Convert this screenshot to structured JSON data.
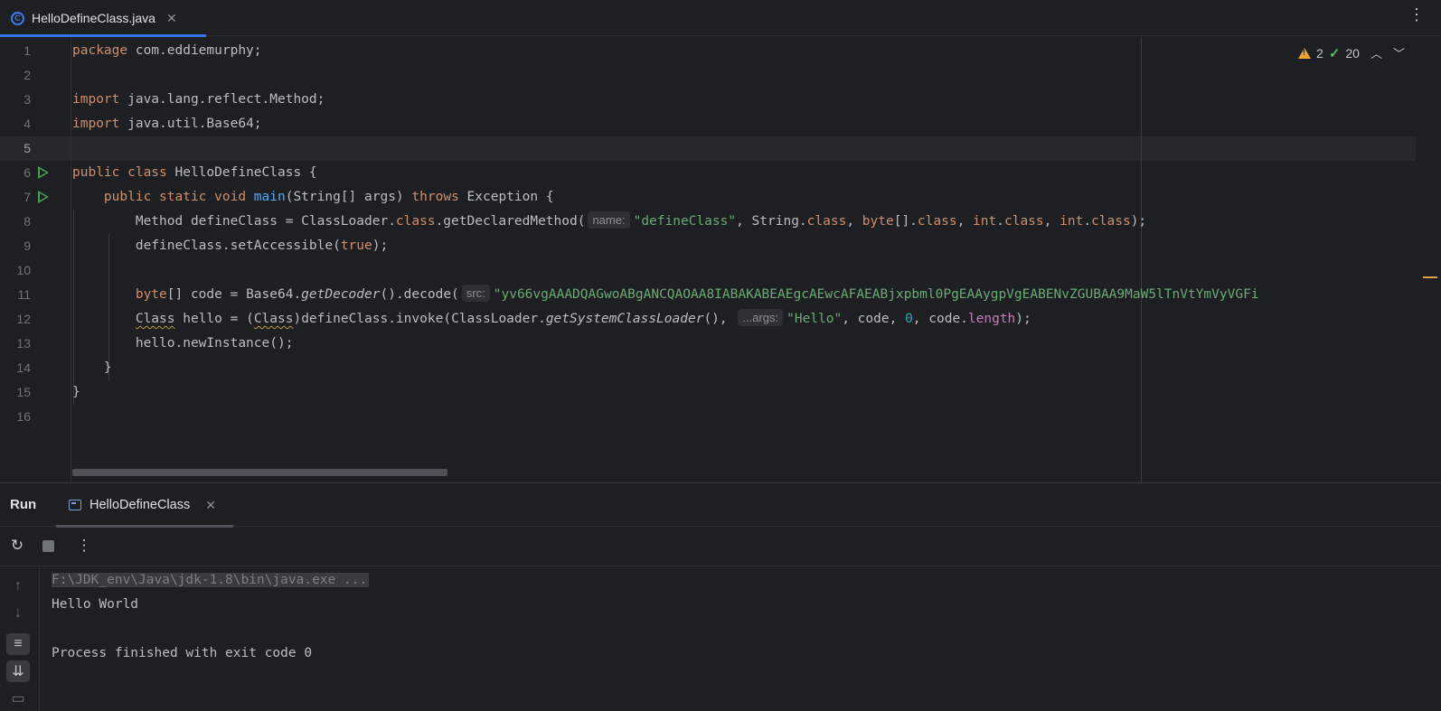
{
  "editor_tab": {
    "title": "HelloDefineClass.java",
    "close": "✕"
  },
  "tab_menu": "⋮",
  "inspection": {
    "warnings": "2",
    "typos": "20"
  },
  "line_numbers": [
    "1",
    "2",
    "3",
    "4",
    "5",
    "6",
    "7",
    "8",
    "9",
    "10",
    "11",
    "12",
    "13",
    "14",
    "15",
    "16"
  ],
  "code": {
    "l1_kw": "package",
    "l1_rest": " com.eddiemurphy;",
    "l3_kw": "import",
    "l3_rest": " java.lang.reflect.Method;",
    "l4_kw": "import",
    "l4_rest": " java.util.Base64;",
    "l6_kw": "public class",
    "l6_rest": " HelloDefineClass {",
    "l7_indent": "    ",
    "l7_kw1": "public static void",
    "l7_fn": " main",
    "l7_mid": "(String[] args) ",
    "l7_kw2": "throws",
    "l7_rest": " Exception {",
    "l8_a": "        Method defineClass = ClassLoader.",
    "l8_kw1": "class",
    "l8_b": ".getDeclaredMethod(",
    "l8_hint": "name:",
    "l8_str": "\"defineClass\"",
    "l8_c": ", String.",
    "l8_kw2": "class",
    "l8_d": ", ",
    "l8_kw3": "byte",
    "l8_e": "[].",
    "l8_kw4": "class",
    "l8_f": ", ",
    "l8_kw5": "int",
    "l8_g": ".",
    "l8_kw6": "class",
    "l8_h": ", ",
    "l8_kw7": "int",
    "l8_i": ".",
    "l8_kw8": "class",
    "l8_j": ");",
    "l9_a": "        defineClass.setAccessible(",
    "l9_kw": "true",
    "l9_b": ");",
    "l11_indent": "        ",
    "l11_kw": "byte",
    "l11_a": "[] code = Base64.",
    "l11_it": "getDecoder",
    "l11_b": "().decode(",
    "l11_hint": "src:",
    "l11_str": "\"yv66vgAAADQAGwoABgANCQAOAA8IABAKABEAEgcAEwcAFAEABjxpbml0PgEAAygpVgEABENvZGUBAA9MaW5lTnVtYmVyVGFi",
    "l12_indent": "        ",
    "l12_a": "Class",
    "l12_b": " hello = (",
    "l12_c": "Class",
    "l12_d": ")defineClass.invoke(ClassLoader.",
    "l12_it": "getSystemClassLoader",
    "l12_e": "(), ",
    "l12_hint": "...args:",
    "l12_str": "\"Hello\"",
    "l12_f": ", code, ",
    "l12_num": "0",
    "l12_g": ", code.",
    "l12_field": "length",
    "l12_h": ");",
    "l13": "        hello.newInstance();",
    "l14": "    }",
    "l15": "}"
  },
  "run_panel": {
    "title": "Run",
    "tab_label": "HelloDefineClass",
    "tab_close": "✕",
    "console": {
      "command": "F:\\JDK_env\\Java\\jdk-1.8\\bin\\java.exe ...",
      "output": "Hello World",
      "exit": "Process finished with exit code 0"
    }
  }
}
